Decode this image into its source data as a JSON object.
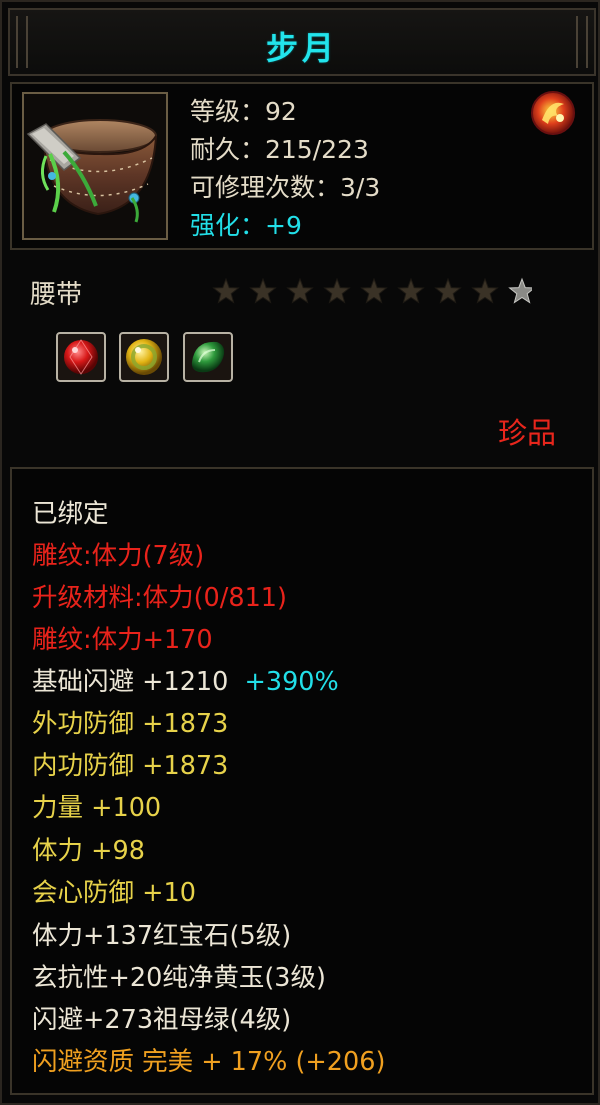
{
  "title": "步月",
  "stats": {
    "level": "等级：92",
    "durability": "耐久：215/223",
    "repair": "可修理次数：3/3",
    "enhance": "强化：+9"
  },
  "item_type": "腰带",
  "stars": {
    "filled": 8,
    "total": 9
  },
  "gems": [
    "red-gem-icon",
    "yellow-gem-icon",
    "green-gem-icon"
  ],
  "rarity": "珍品",
  "attributes": {
    "bound": "已绑定",
    "engrave_level": "雕纹:体力(7级)",
    "upgrade_material": "升级材料:体力(0/811)",
    "engrave_bonus": "雕纹:体力+170",
    "dodge_label": "基础闪避 +1210",
    "dodge_pct": "+390%",
    "outer_def": "外功防御 +1873",
    "inner_def": "内功防御 +1873",
    "strength": "力量 +100",
    "vitality": "体力 +98",
    "crit_def": "会心防御 +10",
    "gem1": "体力+137红宝石(5级)",
    "gem2": "玄抗性+20纯净黄玉(3级)",
    "gem3": "闪避+273祖母绿(4级)",
    "aptitude": "闪避资质 完美 + 17% (+206)"
  },
  "colors": {
    "title": "#22e4ec",
    "white": "#ece6d6",
    "red": "#e9231b",
    "yellow": "#e7d24a",
    "orange": "#f0a020",
    "cyan": "#22dfe8"
  }
}
